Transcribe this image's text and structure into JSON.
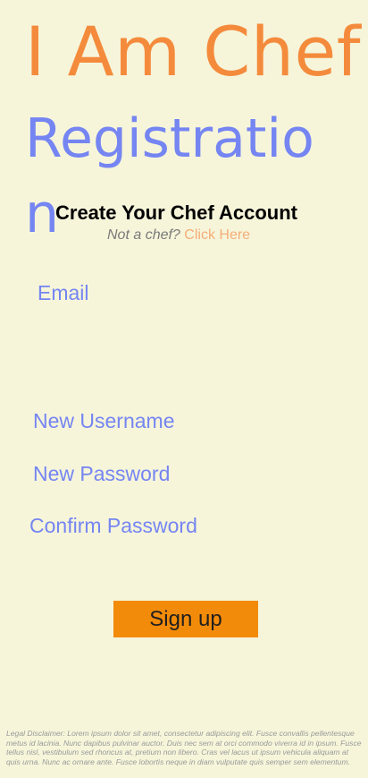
{
  "app": {
    "title": "I Am Chef",
    "subtitle": "Registration"
  },
  "form": {
    "heading": "Create Your Chef Account",
    "not_chef_text": "Not a chef?",
    "click_here_label": "Click Here",
    "email_placeholder": "Email",
    "username_placeholder": "New Username",
    "password_placeholder": "New Password",
    "confirm_placeholder": "Confirm Password",
    "signup_label": "Sign up"
  },
  "footer": {
    "disclaimer": "Legal Disclaimer: Lorem ipsum dolor sit amet, consectetur adipiscing elit. Fusce convallis pellentesque metus id lacinia. Nunc dapibus pulvinar auctor. Duis nec sem at orci commodo viverra id in ipsum. Fusce tellus nisl, vestibulum sed rhoncus at, pretium non libero. Cras vel lacus ut ipsum vehicula aliquam at quis urna. Nunc ac ornare ante. Fusce lobortis neque in diam vulputate quis semper sem elementum."
  },
  "colors": {
    "background": "#f6f5da",
    "title": "#f48b3c",
    "accent_blue": "#7585f2",
    "link": "#f5ad78",
    "button": "#f38b0a"
  }
}
